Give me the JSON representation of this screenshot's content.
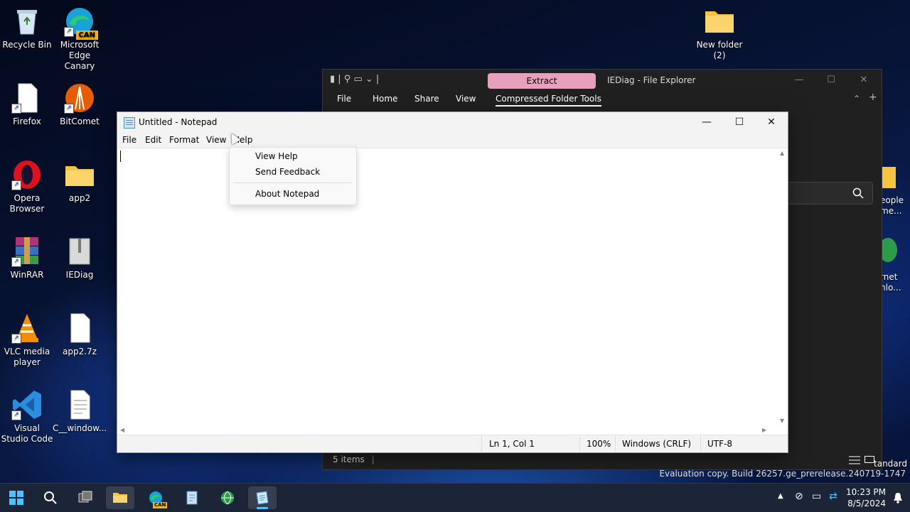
{
  "desktop": {
    "icons": [
      {
        "label": "Recycle Bin"
      },
      {
        "label": "Microsoft Edge Canary",
        "badge": "CAN"
      },
      {
        "label": "Firefox"
      },
      {
        "label": "BitComet"
      },
      {
        "label": "Opera Browser"
      },
      {
        "label": "app2"
      },
      {
        "label": "WinRAR"
      },
      {
        "label": "IEDiag"
      },
      {
        "label": "VLC media player"
      },
      {
        "label": "app2.7z"
      },
      {
        "label": "Visual Studio Code"
      },
      {
        "label": "C__window..."
      },
      {
        "label": "New folder (2)"
      }
    ],
    "partial_labels": [
      "eople",
      "me...",
      "rnet",
      "nlo...",
      "tandard"
    ],
    "watermark": "Evaluation copy. Build 26257.ge_prerelease.240719-1747"
  },
  "explorer": {
    "title": "IEDiag - File Explorer",
    "extract_label": "Extract",
    "tabs": [
      "File",
      "Home",
      "Share",
      "View",
      "Compressed Folder Tools"
    ],
    "status": "5 items",
    "controls": {
      "minimize": "—",
      "maximize": "☐",
      "close": "✕",
      "collapse": "⌃",
      "add": "+"
    }
  },
  "notepad": {
    "title": "Untitled - Notepad",
    "menu": [
      "File",
      "Edit",
      "Format",
      "View",
      "Help"
    ],
    "controls": {
      "minimize": "—",
      "maximize": "☐",
      "close": "✕"
    },
    "status": {
      "position": "Ln 1, Col 1",
      "zoom": "100%",
      "line_ending": "Windows (CRLF)",
      "encoding": "UTF-8"
    }
  },
  "help_menu": {
    "items": [
      "View Help",
      "Send Feedback",
      "About Notepad"
    ]
  },
  "taskbar": {
    "clock_time": "10:23 PM",
    "clock_date": "8/5/2024",
    "edge_badge": "CAN"
  },
  "colors": {
    "accent": "#1a73e8",
    "extract_bg": "#e8a0bf",
    "taskbar": "#1c2438"
  }
}
